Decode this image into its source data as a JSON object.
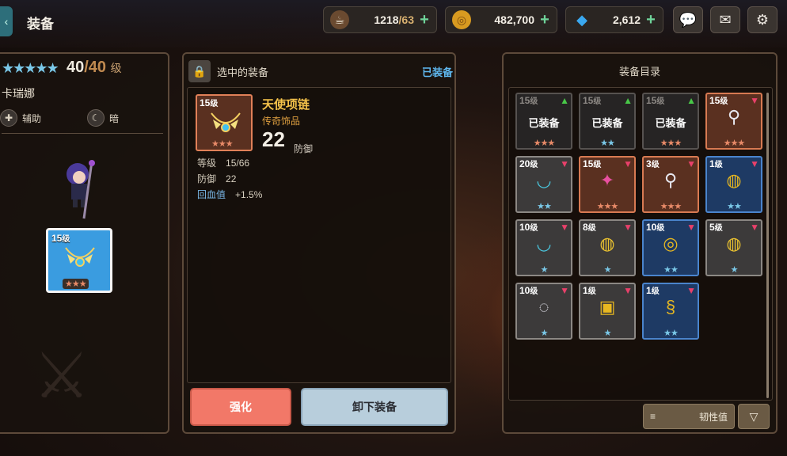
{
  "header": {
    "title": "装备",
    "stamina": {
      "value": "1218",
      "max": "/63"
    },
    "gold": {
      "value": "482,700"
    },
    "gems": {
      "value": "2,612"
    }
  },
  "character": {
    "level": "40",
    "max_level": "/40",
    "level_unit": "级",
    "name": "卡瑞娜",
    "role": "辅助",
    "element": "暗",
    "slot": {
      "level": "15",
      "unit": "级",
      "stars": "★★★"
    }
  },
  "selected": {
    "header": "选中的装备",
    "status": "已装备",
    "card": {
      "level": "15",
      "unit": "级",
      "stars": "★★★"
    },
    "name": "天使项链",
    "rarity": "传奇饰品",
    "power": "22",
    "power_label": "防御",
    "stats": [
      {
        "key": "等级",
        "value": "15/66"
      },
      {
        "key": "防御",
        "value": "22"
      },
      {
        "key": "回血值",
        "value": "+1.5%"
      }
    ]
  },
  "actions": {
    "enhance": "强化",
    "unequip": "卸下装备"
  },
  "catalog": {
    "title": "装备目录",
    "equipped_label": "已装备",
    "items": [
      {
        "level": "15",
        "unit": "级",
        "mark": "▲",
        "stars": "★★★",
        "equipped": true
      },
      {
        "level": "15",
        "unit": "级",
        "mark": "▲",
        "stars": "★★",
        "equipped": true
      },
      {
        "level": "15",
        "unit": "级",
        "mark": "▲",
        "stars": "★★★",
        "equipped": true
      },
      {
        "level": "15",
        "unit": "级",
        "mark": "▼",
        "stars": "★★★"
      },
      {
        "level": "20",
        "unit": "级",
        "mark": "▼",
        "stars": "★★"
      },
      {
        "level": "15",
        "unit": "级",
        "mark": "▼",
        "stars": "★★★"
      },
      {
        "level": "3",
        "unit": "级",
        "mark": "▼",
        "stars": "★★★"
      },
      {
        "level": "1",
        "unit": "级",
        "mark": "▼",
        "stars": "★★"
      },
      {
        "level": "10",
        "unit": "级",
        "mark": "▼",
        "stars": "★"
      },
      {
        "level": "8",
        "unit": "级",
        "mark": "▼",
        "stars": "★"
      },
      {
        "level": "10",
        "unit": "级",
        "mark": "▼",
        "stars": "★★"
      },
      {
        "level": "5",
        "unit": "级",
        "mark": "▼",
        "stars": "★"
      },
      {
        "level": "10",
        "unit": "级",
        "mark": "▼",
        "stars": "★"
      },
      {
        "level": "1",
        "unit": "级",
        "mark": "▼",
        "stars": "★"
      },
      {
        "level": "1",
        "unit": "级",
        "mark": "▼",
        "stars": "★★"
      }
    ],
    "filter_label": "韧性值"
  }
}
